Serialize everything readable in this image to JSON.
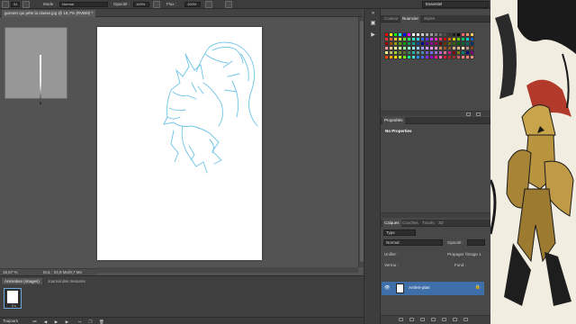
{
  "options_bar": {
    "tool_size": "31",
    "mode_label": "Mode :",
    "mode_value": "Normal",
    "opacity_label": "Opacité :",
    "opacity_value": "100%",
    "flow_label": "Flux :",
    "flow_value": "100%",
    "workspace": "Essentiel"
  },
  "document": {
    "tab_title": "gonnen qui pète la classe.jpg @ 16,7% (RVB/8) *",
    "zoom": "16,67 %",
    "doc_size": "Doc : 24,9 Mo/9,7 Mo"
  },
  "bottom_panel": {
    "tabs": [
      "Animation (images)",
      "Journal des mesures"
    ],
    "frame_duration": "0 s",
    "loop_value": "Toujours"
  },
  "color_panel": {
    "tabs": [
      "Couleur",
      "Nuancier",
      "Styles"
    ]
  },
  "swatches": [
    "#ff0000",
    "#ffff00",
    "#00ff00",
    "#00ffff",
    "#0000ff",
    "#ff00ff",
    "#ffffff",
    "#e6e6e6",
    "#cccccc",
    "#b3b3b3",
    "#999999",
    "#808080",
    "#666666",
    "#4d4d4d",
    "#333333",
    "#1a1a1a",
    "#000000",
    "#ff6666",
    "#ff9966",
    "#ffcc66",
    "#ff3333",
    "#ff6633",
    "#ffcc33",
    "#ccff33",
    "#66ff33",
    "#33ff66",
    "#33ffcc",
    "#33ccff",
    "#3366ff",
    "#6633ff",
    "#cc33ff",
    "#ff33cc",
    "#ff3366",
    "#cc0000",
    "#cc6600",
    "#cccc00",
    "#66cc00",
    "#00cc66",
    "#00cccc",
    "#0066cc",
    "#990000",
    "#994d00",
    "#999900",
    "#4d9900",
    "#009900",
    "#00994d",
    "#009999",
    "#004d99",
    "#000099",
    "#4d0099",
    "#990099",
    "#99004d",
    "#660000",
    "#663300",
    "#666600",
    "#336600",
    "#006600",
    "#006633",
    "#006666",
    "#003366",
    "#ff9999",
    "#ffcc99",
    "#ffff99",
    "#ccff99",
    "#99ff99",
    "#99ffcc",
    "#99ffff",
    "#99ccff",
    "#9999ff",
    "#cc99ff",
    "#ff99ff",
    "#ff99cc",
    "#c68c53",
    "#a0522d",
    "#8b5a2b",
    "#d2b48c",
    "#deb887",
    "#f5deb3",
    "#bc8f8f",
    "#8b4513",
    "#f0e68c",
    "#bdb76b",
    "#9acd32",
    "#6b8e23",
    "#556b2f",
    "#2e8b57",
    "#20b2aa",
    "#5f9ea0",
    "#4682b4",
    "#6a5acd",
    "#7b68ee",
    "#9370db",
    "#ba55d3",
    "#db7093",
    "#c71585",
    "#800000",
    "#808000",
    "#008080",
    "#000080",
    "#800080",
    "#ff4500",
    "#ffa500",
    "#ffd700",
    "#adff2f",
    "#7fff00",
    "#00fa9a",
    "#40e0d0",
    "#1e90ff",
    "#4169e1",
    "#8a2be2",
    "#9400d3",
    "#ff1493",
    "#ff69b4",
    "#dc143c",
    "#b22222",
    "#a52a2a",
    "#cd5c5c",
    "#f08080",
    "#fa8072",
    "#e9967a"
  ],
  "properties_panel": {
    "tab": "Propriétés",
    "title": "No Properties"
  },
  "layers_panel": {
    "tabs": [
      "Calques",
      "Couches",
      "Tracés",
      "3D"
    ],
    "filter_kind": "Type",
    "blend_mode": "Normal",
    "opacity_label": "Opacité :",
    "opacity_value": "",
    "lock_label": "Verrou :",
    "propagate_label": "Propager l'image 1",
    "fill_label": "Fond :",
    "unify_label": "Unifier :",
    "layer_name": "Arrière-plan"
  }
}
